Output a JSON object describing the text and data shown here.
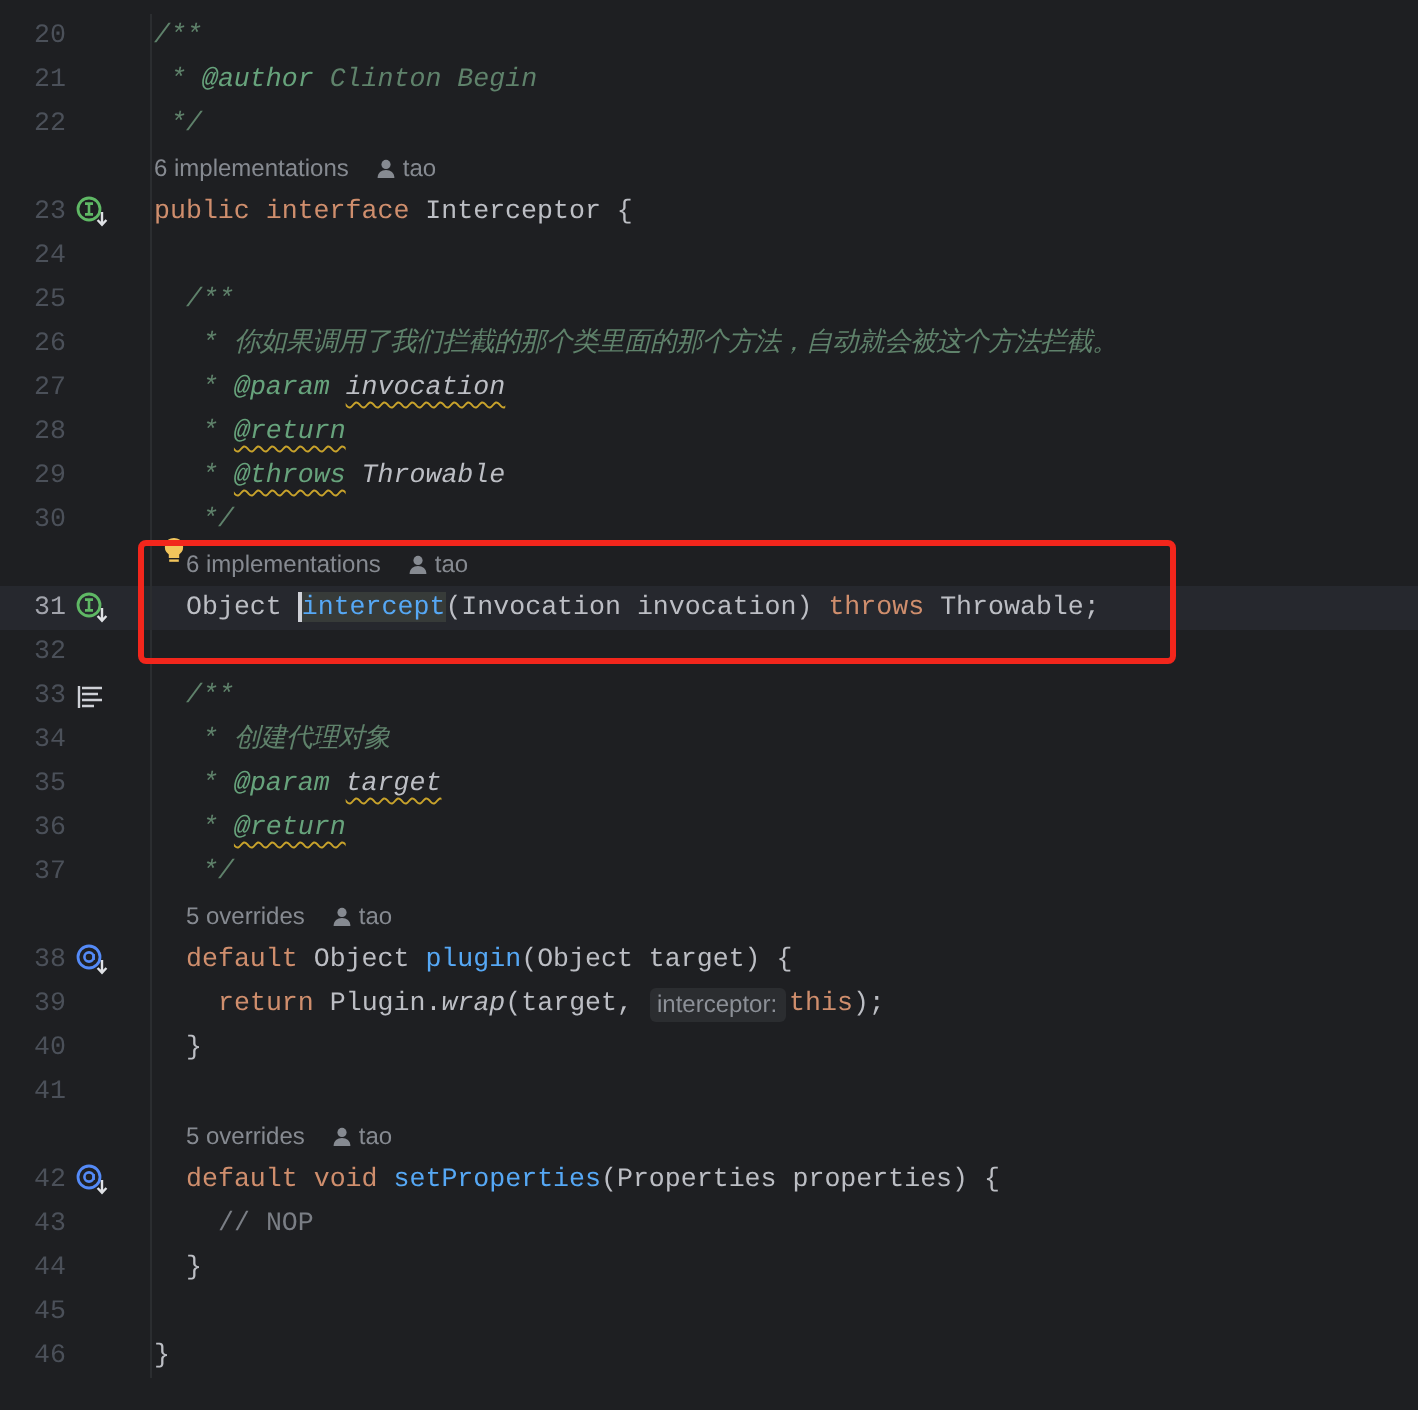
{
  "editor": {
    "rows": [
      {
        "kind": "code",
        "number": "20",
        "tokens": [
          {
            "text": "/**",
            "kind": "doc"
          }
        ]
      },
      {
        "kind": "code",
        "number": "21",
        "tokens": [
          {
            "text": " * ",
            "kind": "doc"
          },
          {
            "text": "@author ",
            "kind": "tag"
          },
          {
            "text": "Clinton Begin",
            "kind": "doc"
          }
        ]
      },
      {
        "kind": "code",
        "number": "22",
        "tokens": [
          {
            "text": " */",
            "kind": "doc"
          }
        ]
      },
      {
        "kind": "inlay",
        "label": "6 implementations",
        "author": "tao",
        "bulb": false
      },
      {
        "kind": "code",
        "number": "23",
        "marker": {
          "kind": "implemented"
        },
        "tokens": [
          {
            "text": "public ",
            "kind": "keyword"
          },
          {
            "text": "interface ",
            "kind": "keyword"
          },
          {
            "text": "Interceptor {",
            "kind": "plain"
          }
        ]
      },
      {
        "kind": "code",
        "number": "24",
        "tokens": []
      },
      {
        "kind": "code",
        "number": "25",
        "tokens": [
          {
            "text": "  /**",
            "kind": "doc"
          }
        ]
      },
      {
        "kind": "code",
        "number": "26",
        "tokens": [
          {
            "text": "   * 你如果调用了我们拦截的那个类里面的那个方法，自动就会被这个方法拦截。",
            "kind": "doc"
          }
        ]
      },
      {
        "kind": "code",
        "number": "27",
        "tokens": [
          {
            "text": "   * ",
            "kind": "doc"
          },
          {
            "text": "@param ",
            "kind": "tag"
          },
          {
            "text": "invocation",
            "kind": "ref",
            "warning": true
          }
        ]
      },
      {
        "kind": "code",
        "number": "28",
        "tokens": [
          {
            "text": "   * ",
            "kind": "doc"
          },
          {
            "text": "@return",
            "kind": "tag",
            "warning": true
          }
        ]
      },
      {
        "kind": "code",
        "number": "29",
        "tokens": [
          {
            "text": "   * ",
            "kind": "doc"
          },
          {
            "text": "@throws",
            "kind": "tag",
            "warning": true
          },
          {
            "text": " Throwable",
            "kind": "ref"
          }
        ]
      },
      {
        "kind": "code",
        "number": "30",
        "tokens": [
          {
            "text": "   */",
            "kind": "doc"
          }
        ]
      },
      {
        "kind": "box",
        "rows": [
          {
            "kind": "inlay",
            "label": "6 implementations",
            "author": "tao",
            "bulb": true
          },
          {
            "kind": "code",
            "number": "31",
            "marker": {
              "kind": "implemented"
            },
            "current": true,
            "tokens": [
              {
                "text": "  Object ",
                "kind": "plain"
              },
              {
                "text": "intercept",
                "kind": "method",
                "caret": true,
                "highlighted": true
              },
              {
                "text": "(Invocation invocation) ",
                "kind": "plain"
              },
              {
                "text": "throws",
                "kind": "keyword"
              },
              {
                "text": " Throwable;",
                "kind": "plain"
              }
            ]
          }
        ]
      },
      {
        "kind": "code",
        "number": "32",
        "tokens": []
      },
      {
        "kind": "code",
        "number": "33",
        "marker": {
          "kind": "structure"
        },
        "tokens": [
          {
            "text": "  /**",
            "kind": "doc"
          }
        ]
      },
      {
        "kind": "code",
        "number": "34",
        "tokens": [
          {
            "text": "   * 创建代理对象",
            "kind": "doc"
          }
        ]
      },
      {
        "kind": "code",
        "number": "35",
        "tokens": [
          {
            "text": "   * ",
            "kind": "doc"
          },
          {
            "text": "@param ",
            "kind": "tag"
          },
          {
            "text": "target",
            "kind": "ref",
            "warning": true
          }
        ]
      },
      {
        "kind": "code",
        "number": "36",
        "tokens": [
          {
            "text": "   * ",
            "kind": "doc"
          },
          {
            "text": "@return",
            "kind": "tag",
            "warning": true
          }
        ]
      },
      {
        "kind": "code",
        "number": "37",
        "tokens": [
          {
            "text": "   */",
            "kind": "doc"
          }
        ]
      },
      {
        "kind": "inlay",
        "label": "5 overrides",
        "author": "tao",
        "bulb": false
      },
      {
        "kind": "code",
        "number": "38",
        "marker": {
          "kind": "overrides"
        },
        "tokens": [
          {
            "text": "  default",
            "kind": "keyword"
          },
          {
            "text": " Object ",
            "kind": "plain"
          },
          {
            "text": "plugin",
            "kind": "method"
          },
          {
            "text": "(Object target) {",
            "kind": "plain"
          }
        ]
      },
      {
        "kind": "code",
        "number": "39",
        "tokens": [
          {
            "text": "    return",
            "kind": "keyword"
          },
          {
            "text": " Plugin.",
            "kind": "plain"
          },
          {
            "text": "wrap",
            "kind": "static"
          },
          {
            "text": "(target,",
            "kind": "plain"
          },
          {
            "text": "interceptor:",
            "kind": "hint"
          },
          {
            "text": "this",
            "kind": "keyword"
          },
          {
            "text": ");",
            "kind": "plain"
          }
        ]
      },
      {
        "kind": "code",
        "number": "40",
        "tokens": [
          {
            "text": "  }",
            "kind": "plain"
          }
        ]
      },
      {
        "kind": "code",
        "number": "41",
        "tokens": []
      },
      {
        "kind": "inlay",
        "label": "5 overrides",
        "author": "tao",
        "bulb": false
      },
      {
        "kind": "code",
        "number": "42",
        "marker": {
          "kind": "overrides"
        },
        "tokens": [
          {
            "text": "  default ",
            "kind": "keyword"
          },
          {
            "text": "void ",
            "kind": "keyword"
          },
          {
            "text": "setProperties",
            "kind": "method"
          },
          {
            "text": "(Properties properties) {",
            "kind": "plain"
          }
        ]
      },
      {
        "kind": "code",
        "number": "43",
        "tokens": [
          {
            "text": "    // NOP",
            "kind": "comment"
          }
        ]
      },
      {
        "kind": "code",
        "number": "44",
        "tokens": [
          {
            "text": "  }",
            "kind": "plain"
          }
        ]
      },
      {
        "kind": "code",
        "number": "45",
        "tokens": []
      },
      {
        "kind": "code",
        "number": "46",
        "tokens": [
          {
            "text": "}",
            "kind": "plain"
          }
        ]
      }
    ]
  }
}
